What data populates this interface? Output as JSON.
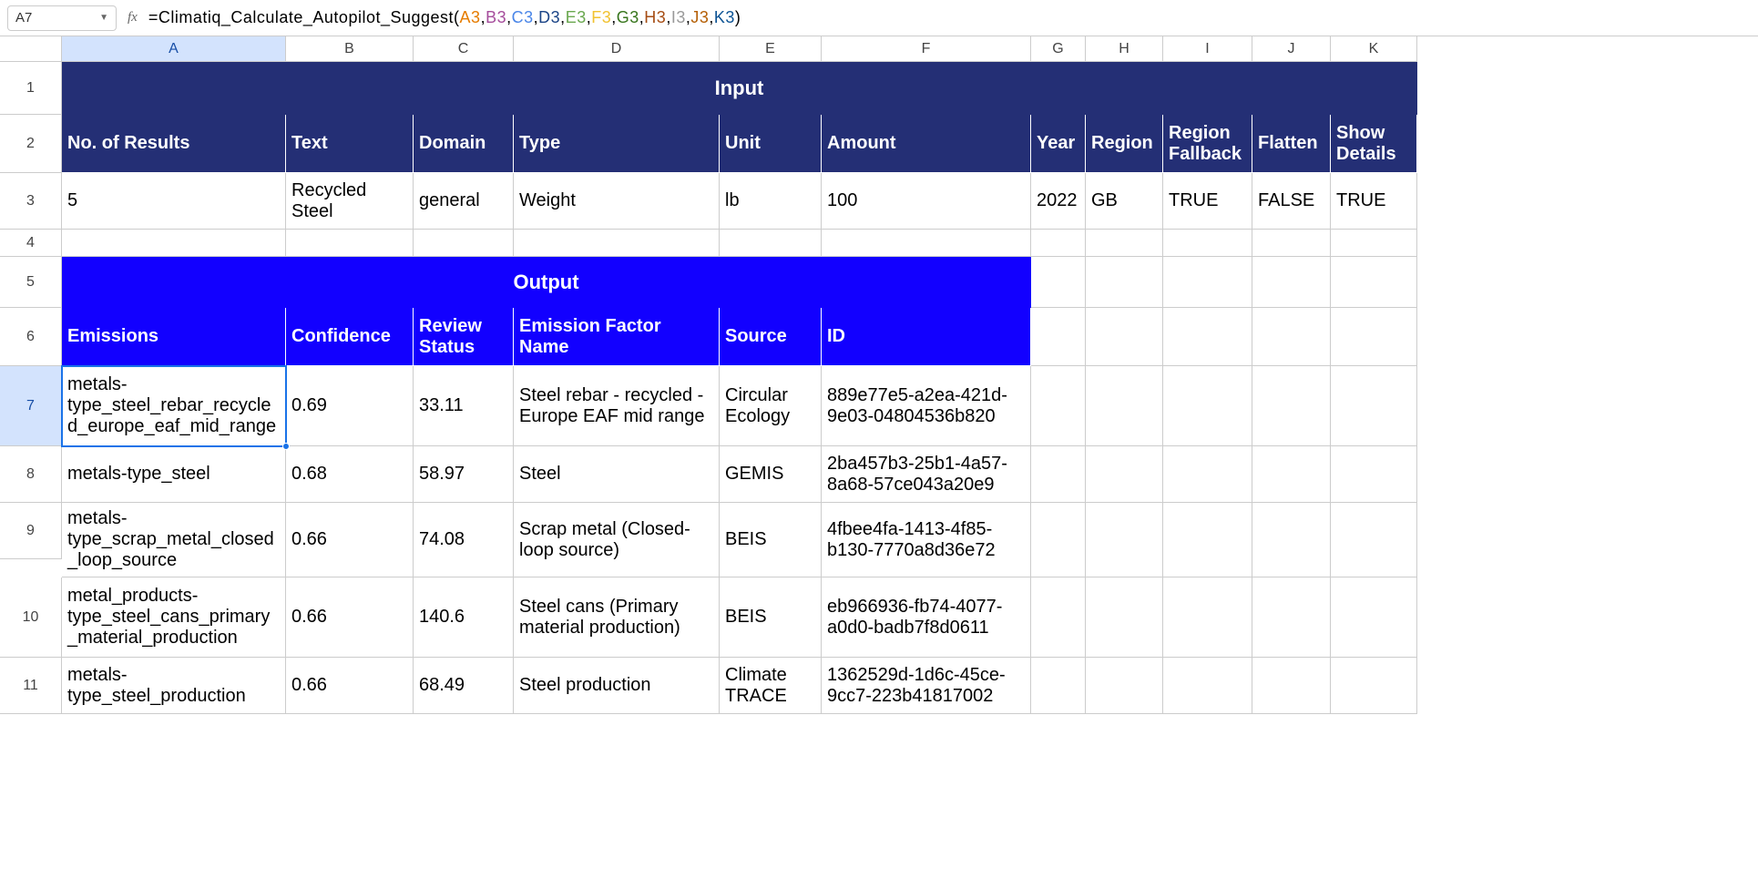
{
  "nameBox": "A7",
  "formulaPrefix": "=Climatiq_Calculate_Autopilot_Suggest(",
  "formulaRefs": [
    "A3",
    "B3",
    "C3",
    "D3",
    "E3",
    "F3",
    "G3",
    "H3",
    "I3",
    "J3",
    "K3"
  ],
  "columns": [
    "A",
    "B",
    "C",
    "D",
    "E",
    "F",
    "G",
    "H",
    "I",
    "J",
    "K"
  ],
  "rows": [
    "1",
    "2",
    "3",
    "4",
    "5",
    "6",
    "7",
    "8",
    "9",
    "10",
    "11"
  ],
  "inputTitle": "Input",
  "outputTitle": "Output",
  "inputHeaders": {
    "a": "No. of Results",
    "b": "Text",
    "c": "Domain",
    "d": "Type",
    "e": "Unit",
    "f": "Amount",
    "g": "Year",
    "h": "Region",
    "i": "Region Fallback",
    "j": "Flatten",
    "k": "Show Details"
  },
  "inputData": {
    "a": "5",
    "b": "Recycled Steel",
    "c": "general",
    "d": "Weight",
    "e": "lb",
    "f": "100",
    "g": "2022",
    "h": "GB",
    "i": "TRUE",
    "j": "FALSE",
    "k": "TRUE"
  },
  "outputHeaders": {
    "a": "Emissions",
    "b": "Confidence",
    "c": "Review Status",
    "d": "Emission Factor Name",
    "e": "Source",
    "f": "ID"
  },
  "outputRows": [
    {
      "a": "metals-type_steel_rebar_recycled_europe_eaf_mid_range",
      "b": "0.69",
      "c": "33.11",
      "d": "Steel rebar - recycled - Europe EAF mid range",
      "e": "Circular Ecology",
      "f": "889e77e5-a2ea-421d-9e03-04804536b820"
    },
    {
      "a": "metals-type_steel",
      "b": "0.68",
      "c": "58.97",
      "d": "Steel",
      "e": "GEMIS",
      "f": "2ba457b3-25b1-4a57-8a68-57ce043a20e9"
    },
    {
      "a": "metals-type_scrap_metal_closed_loop_source",
      "b": "0.66",
      "c": "74.08",
      "d": "Scrap metal (Closed-loop source)",
      "e": "BEIS",
      "f": "4fbee4fa-1413-4f85-b130-7770a8d36e72"
    },
    {
      "a": "metal_products-type_steel_cans_primary_material_production",
      "b": "0.66",
      "c": "140.6",
      "d": "Steel cans (Primary material production)",
      "e": "BEIS",
      "f": "eb966936-fb74-4077-a0d0-badb7f8d0611"
    },
    {
      "a": "metals-type_steel_production",
      "b": "0.66",
      "c": "68.49",
      "d": "Steel production",
      "e": "Climate TRACE",
      "f": "1362529d-1d6c-45ce-9cc7-223b41817002"
    }
  ]
}
